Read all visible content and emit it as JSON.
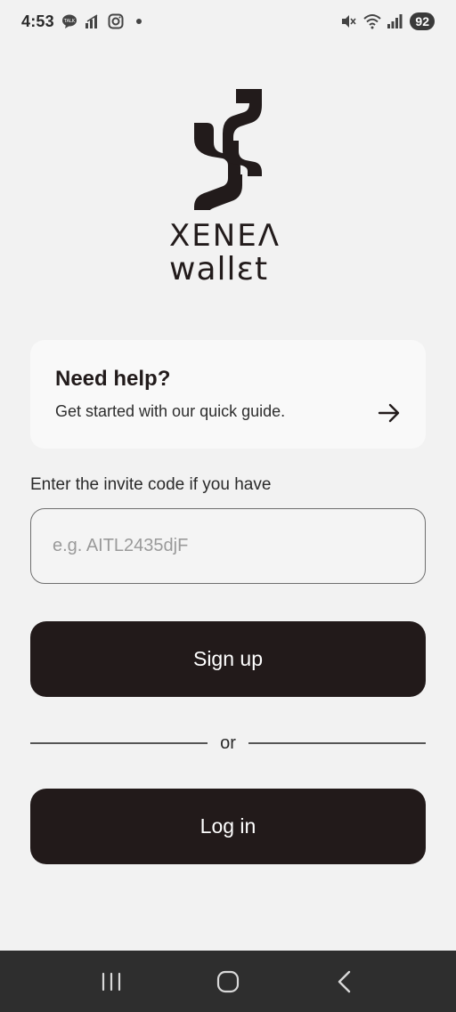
{
  "status_bar": {
    "time": "4:53",
    "battery": "92",
    "icons": [
      "talk-icon",
      "signal-activity-icon",
      "instagram-icon",
      "mute-icon",
      "wifi-icon",
      "cell-signal-icon"
    ]
  },
  "logo": {
    "line1": "XENEΛ",
    "line2": "wallɛt"
  },
  "help_card": {
    "title": "Need help?",
    "subtitle": "Get started with our quick guide."
  },
  "invite": {
    "label": "Enter the invite code if you have",
    "placeholder": "e.g. AITL2435djF",
    "value": ""
  },
  "buttons": {
    "signup": "Sign up",
    "divider": "or",
    "login": "Log in"
  },
  "nav": {
    "recents": "recent-apps-icon",
    "home": "home-icon",
    "back": "back-icon"
  },
  "colors": {
    "background": "#f2f2f2",
    "primary_button": "#221a1a",
    "card": "#f9f9f9"
  }
}
